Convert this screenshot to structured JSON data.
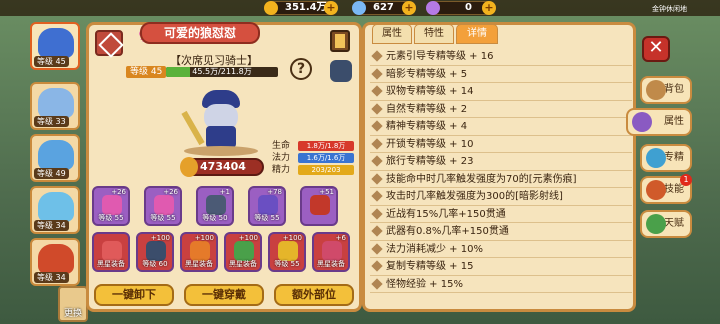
{
  "topbar": {
    "gold": "351.4万",
    "diamond": "627",
    "gems": "0",
    "corner_label": "金钟休闲地"
  },
  "hero_tabs": [
    {
      "level": "等级 45",
      "active": true,
      "color": "#3f6fd1"
    },
    {
      "level": "等级 33",
      "active": false,
      "color": "#8ab6e6"
    },
    {
      "level": "等级 49",
      "active": false,
      "color": "#5aa3e0"
    },
    {
      "level": "等级 34",
      "active": false,
      "color": "#6ec0e8"
    },
    {
      "level": "等级 34",
      "active": false,
      "color": "#d04a2a"
    }
  ],
  "swap_label": "更换",
  "hero": {
    "name": "可爱的狼怼怼",
    "class_title": "【次席见习骑士】",
    "level_label": "等级 45",
    "exp_text": "45.5万/211.8万",
    "exp_fraction": 0.215,
    "power": "473404",
    "stats": [
      {
        "key": "生命",
        "value": "1.8万/1.8万",
        "color": "#d7392b"
      },
      {
        "key": "法力",
        "value": "1.6万/1.6万",
        "color": "#3a74d1"
      },
      {
        "key": "精力",
        "value": "203/203",
        "color": "#e3a91a"
      }
    ]
  },
  "equipment": [
    {
      "count": "+26",
      "label": "等级 55",
      "bg": "#9b5fc2",
      "art": "#e05ab0"
    },
    {
      "count": "+26",
      "label": "等级 55",
      "bg": "#9b5fc2",
      "art": "#e05ab0"
    },
    {
      "count": "+1",
      "label": "等级 50",
      "bg": "#9b5fc2",
      "art": "#4b5a75"
    },
    {
      "count": "+78",
      "label": "等级 55",
      "bg": "#9b5fc2",
      "art": "#6a4fc2"
    },
    {
      "count": "+51",
      "label": "",
      "bg": "#9b5fc2",
      "art": "#c2382a"
    },
    {
      "count": "",
      "label": "黑星装备",
      "bg": "#c94040",
      "art": "#e05a5a"
    },
    {
      "count": "+100",
      "label": "等级 60",
      "bg": "#c94040",
      "art": "#3b4d6b"
    },
    {
      "count": "+100",
      "label": "黑星装备",
      "bg": "#c94040",
      "art": "#e57a2a"
    },
    {
      "count": "+100",
      "label": "黑星装备",
      "bg": "#c94040",
      "art": "#4aa04a"
    },
    {
      "count": "+100",
      "label": "等级 55",
      "bg": "#c94040",
      "art": "#e5b52a"
    },
    {
      "count": "+6",
      "label": "黑星装备",
      "bg": "#c94040",
      "art": "#d04a6a"
    }
  ],
  "buttons": {
    "unequip_all": "一键卸下",
    "equip_all": "一键穿戴",
    "extra_slot": "额外部位"
  },
  "detail_tabs": [
    "属性",
    "特性",
    "详情"
  ],
  "details": [
    "元素引导专精等级 + 16",
    "暗影专精等级 + 5",
    "驭物专精等级 + 14",
    "自然专精等级 + 2",
    "精神专精等级 + 4",
    "开锁专精等级 + 10",
    "旅行专精等级 + 23",
    "技能命中时几率触发强度为70的[元素伤痕]",
    "攻击时几率触发强度为300的[暗影射线]",
    "近战有15%几率+150贯通",
    "武器有0.8%几率+150贯通",
    "法力消耗减少 + 10%",
    "复制专精等级 + 15",
    "怪物经验 + 15%"
  ],
  "close_label": "✕",
  "side_menu": [
    {
      "label": "背包",
      "active": false,
      "badge": ""
    },
    {
      "label": "属性",
      "active": true,
      "badge": ""
    },
    {
      "label": "专精",
      "active": false,
      "badge": ""
    },
    {
      "label": "技能",
      "active": false,
      "badge": "1"
    },
    {
      "label": "天赋",
      "active": false,
      "badge": ""
    }
  ]
}
